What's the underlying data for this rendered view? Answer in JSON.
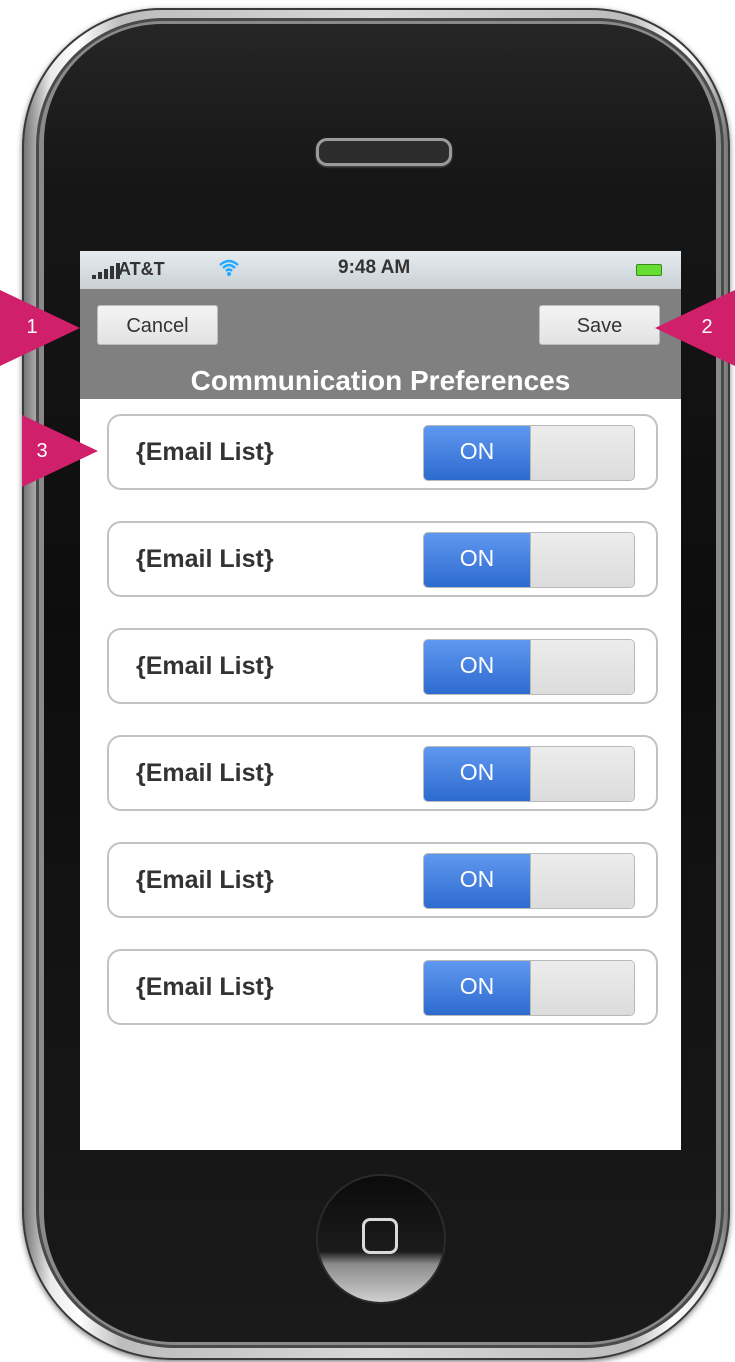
{
  "status_bar": {
    "carrier": "AT&T",
    "time": "9:48 AM"
  },
  "nav": {
    "cancel_label": "Cancel",
    "save_label": "Save",
    "title": "Communication Preferences"
  },
  "list": {
    "items": [
      {
        "label": "{Email List}",
        "toggle": "ON"
      },
      {
        "label": "{Email List}",
        "toggle": "ON"
      },
      {
        "label": "{Email List}",
        "toggle": "ON"
      },
      {
        "label": "{Email List}",
        "toggle": "ON"
      },
      {
        "label": "{Email List}",
        "toggle": "ON"
      },
      {
        "label": "{Email List}",
        "toggle": "ON"
      }
    ]
  },
  "callouts": [
    "1",
    "2",
    "3"
  ],
  "colors": {
    "callout": "#d01f6b",
    "nav_bar": "#808080",
    "toggle_on": "#2e6bd0"
  }
}
